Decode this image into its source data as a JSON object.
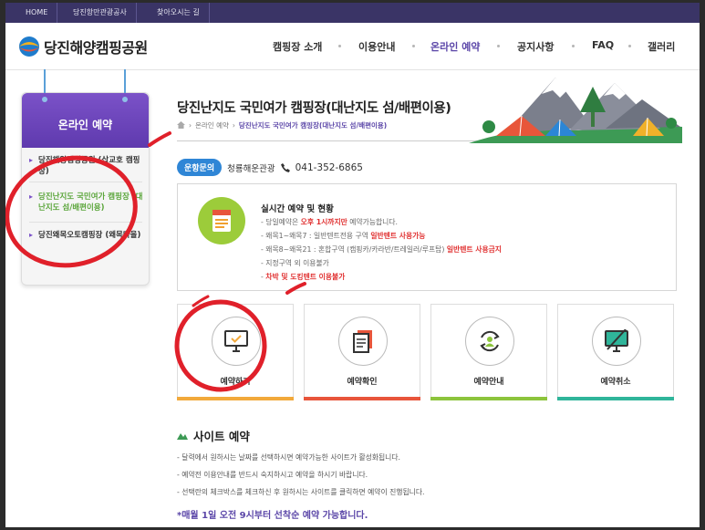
{
  "topbar": {
    "links": [
      "HOME",
      "당진항만관광공사",
      "찾아오시는 길"
    ]
  },
  "logo": {
    "text": "당진해양캠핑공원"
  },
  "nav": {
    "items": [
      "캠핑장 소개",
      "이용안내",
      "온라인 예약",
      "공지사항",
      "FAQ",
      "갤러리"
    ],
    "active": "온라인 예약"
  },
  "sidebar": {
    "title": "온라인 예약",
    "items": [
      {
        "label": "당진해양캠핑공원 (삽교호 캠핑장)"
      },
      {
        "label": "당진난지도 국민여가 캠핑장 (대난지도 섬/배편이용)"
      },
      {
        "label": "당진왜목오토캠핑장 (왜목마을)"
      }
    ]
  },
  "page": {
    "title": "당진난지도 국민여가 캠핑장(대난지도 섬/배편이용)",
    "breadcrumb": [
      "온라인 예약",
      "당진난지도 국민여가 캠핑장(대난지도 섬/배편이용)"
    ]
  },
  "contact": {
    "badge": "운항문의",
    "agency": "청룡해운관광",
    "phone": "041-352-6865"
  },
  "realtime": {
    "title": "실시간 예약 및 현황",
    "l1_pre": "- 당일예약은 ",
    "l1_red": "오후 1시까지만",
    "l1_post": " 예약가능합니다.",
    "l2_pre": "- 왜목1~왜목7 : 일반텐트전용 구역 ",
    "l2_red": "일반텐트 사용가능",
    "l3_pre": "- 왜목8~왜목21 : 혼합구역 (캠핑카/카라반/트레일러/루프탑) ",
    "l3_red": "일반텐트 사용금지",
    "l4": "- 지정구역 외 이용불가",
    "l5_pre": "- ",
    "l5_red": "차박 및 도킹텐트 이용불가"
  },
  "cards": [
    {
      "label": "예약하기",
      "icon": "monitor-check-icon",
      "color": "#f2a93b"
    },
    {
      "label": "예약확인",
      "icon": "document-icon",
      "color": "#e8553b"
    },
    {
      "label": "예약안내",
      "icon": "person-cycle-icon",
      "color": "#8cc43c"
    },
    {
      "label": "예약취소",
      "icon": "monitor-cancel-icon",
      "color": "#2fb59a"
    }
  ],
  "site": {
    "title": "사이트 예약",
    "lines": [
      "- 달력에서 원하시는 날짜를 선택하시면 예약가능한 사이트가 활성화됩니다.",
      "- 예약전 이용안내를 반드시 숙지하시고 예약을 하시기 바랍니다.",
      "- 선택란의 체크박스를 체크하신 후 원하시는 사이트를 클릭하면 예약이 진행됩니다."
    ],
    "notice": "*매월 1일 오전 9시부터 선착순 예약 가능합니다."
  },
  "colors": {
    "brand": "#5b46a8",
    "topbar": "#3a3466",
    "annotation": "#e0202a"
  }
}
